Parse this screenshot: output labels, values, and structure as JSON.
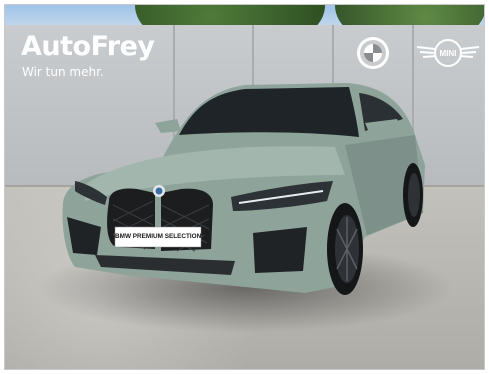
{
  "photo": {
    "dealer": {
      "name": "AutoFrey",
      "slogan": "Wir tun mehr."
    },
    "brand_logos": [
      {
        "name": "BMW",
        "icon": "bmw-roundel-icon"
      },
      {
        "name": "MINI",
        "icon": "mini-wings-icon"
      }
    ],
    "car": {
      "plate_text": "BMW PREMIUM SELECTION",
      "paint_color": "#8ea39a"
    }
  }
}
